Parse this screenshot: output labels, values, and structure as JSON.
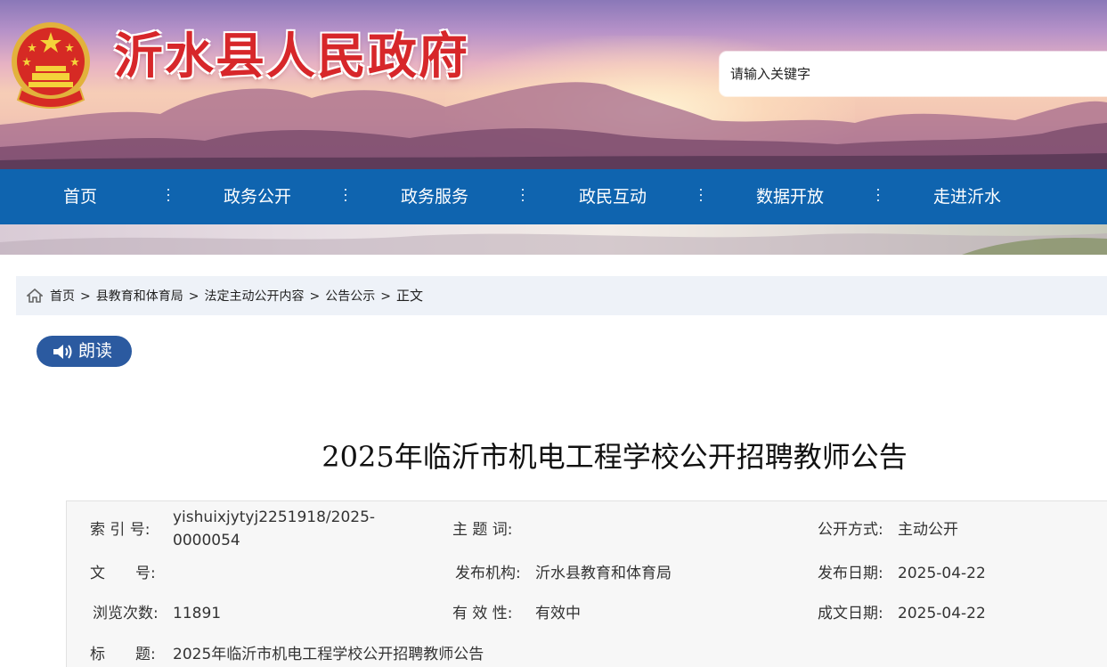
{
  "header": {
    "site_title": "沂水县人民政府",
    "search_placeholder": "请输入关键字"
  },
  "nav": {
    "items": [
      "首页",
      "政务公开",
      "政务服务",
      "政民互动",
      "数据开放",
      "走进沂水"
    ]
  },
  "breadcrumb": {
    "items": [
      "首页",
      "县教育和体育局",
      "法定主动公开内容",
      "公告公示"
    ],
    "separator": ">",
    "current": "正文"
  },
  "read_aloud": {
    "label": "朗读"
  },
  "article": {
    "title": "2025年临沂市机电工程学校公开招聘教师公告"
  },
  "meta": {
    "index_no": {
      "label": "索 引 号:",
      "value_line1": "yishuixjytyj2251918/2025-",
      "value_line2": "0000054"
    },
    "keywords": {
      "label": "主 题 词:",
      "value": ""
    },
    "disclosure": {
      "label": "公开方式:",
      "value": "主动公开"
    },
    "doc_no": {
      "label": "文　　号:",
      "value": ""
    },
    "publisher": {
      "label": "发布机构:",
      "value": "沂水县教育和体育局"
    },
    "publish_date": {
      "label": "发布日期:",
      "value": "2025-04-22"
    },
    "views": {
      "label": "浏览次数:",
      "value": "11891"
    },
    "validity": {
      "label": "有 效 性:",
      "value": "有效中"
    },
    "created_date": {
      "label": "成文日期:",
      "value": "2025-04-22"
    },
    "title_row": {
      "label": "标　　题:",
      "value": "2025年临沂市机电工程学校公开招聘教师公告"
    }
  },
  "colors": {
    "nav_bg": "#0f64af",
    "title_red": "#d7272a",
    "read_btn": "#2b5aa0",
    "crumb_bg": "#eef2f8"
  }
}
